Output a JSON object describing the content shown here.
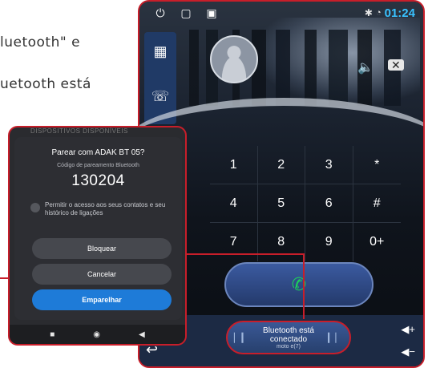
{
  "manual": {
    "line1": "luetooth\" e",
    "line2": "uetooth está"
  },
  "statusbar": {
    "power_icon": "power-icon",
    "window_icon": "window-icon",
    "image_icon": "image-icon",
    "time": "01:24"
  },
  "side_rail": {
    "items": [
      "grid-icon",
      "phone-list-icon"
    ]
  },
  "keypad": {
    "keys": [
      "1",
      "2",
      "3",
      "*",
      "4",
      "5",
      "6",
      "#",
      "7",
      "8",
      "9",
      "0+"
    ]
  },
  "bluetooth_pill": {
    "status": "Bluetooth está conectado",
    "device": "moto e(7)"
  },
  "pair_dialog": {
    "peek_text": "DISPOSITIVOS DISPONÍVEIS",
    "title": "Parear com ADAK BT 05?",
    "code_label": "Código de pareamento Bluetooth",
    "code": "130204",
    "checkbox_text": "Permitir o acesso aos seus contatos e seu histórico de ligações",
    "btn_block": "Bloquear",
    "btn_cancel": "Cancelar",
    "btn_pair": "Emparelhar"
  },
  "colors": {
    "accent_red": "#c81e2a",
    "time_blue": "#39c2ff",
    "pair_blue": "#1e7bd8",
    "call_green": "#1bd15a"
  }
}
